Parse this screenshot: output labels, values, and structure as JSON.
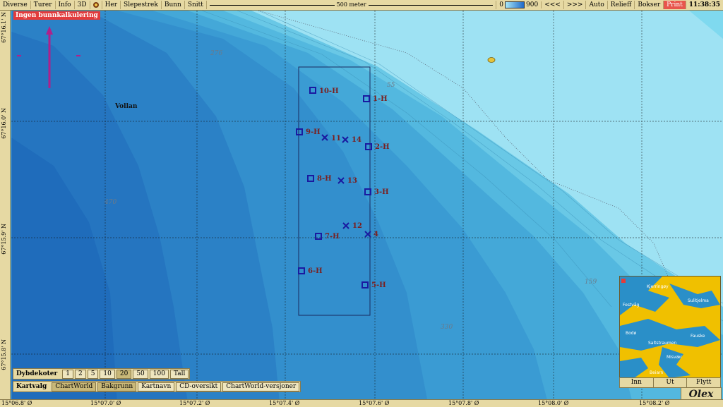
{
  "toolbar": {
    "items": [
      "Diverse",
      "Turer",
      "Info",
      "3D",
      "Her",
      "Slepestrek",
      "Bunn",
      "Snitt"
    ],
    "scale_label": "500 meter",
    "depth_min": "0",
    "depth_max": "900",
    "prev": "<<<",
    "next": ">>>",
    "auto": "Auto",
    "relief": "Relieff",
    "boxes": "Bokser",
    "print": "Print",
    "clock": "11:38:35",
    "colors": {
      "bar": "#e6d9a3",
      "print": "#e8564c"
    }
  },
  "map": {
    "badge": "Ingen bunnkalkulering",
    "place": "Vollan",
    "depths": [
      "276",
      "55",
      "470",
      "330",
      "159"
    ],
    "waypoints_h": [
      "10-H",
      "1-H",
      "9-H",
      "2-H",
      "8-H",
      "3-H",
      "7-H",
      "6-H",
      "5-H"
    ],
    "waypoints_x": [
      "11",
      "14",
      "13",
      "12",
      "4"
    ],
    "colors": {
      "shallow": "#a9e8f6",
      "deep": "#1f69c8",
      "marker": "#1a1aa0"
    }
  },
  "lat_labels": [
    "67°16.1' N",
    "67°16.0' N",
    "67°15.9' N",
    "67°15.8' N"
  ],
  "lon_labels": [
    "15°06.8' Ø",
    "15°07.0' Ø",
    "15°07.2' Ø",
    "15°07.4' Ø",
    "15°07.6' Ø",
    "15°07.8' Ø",
    "15°08.0' Ø",
    "15°08.2' Ø"
  ],
  "dybdekoter": {
    "label": "Dybdekoter",
    "options": [
      "1",
      "2",
      "5",
      "10",
      "20",
      "50",
      "100",
      "Tall"
    ],
    "selected": "20"
  },
  "kartvalg": {
    "label": "Kartvalg",
    "options": [
      "ChartWorld",
      "Bakgrunn",
      "Kartnavn",
      "CD-oversikt",
      "ChartWorld-versjoner"
    ]
  },
  "inset": {
    "buttons": [
      "Inn",
      "Ut",
      "Flytt"
    ],
    "places": [
      "Kjerringøy",
      "Festvåg",
      "Sulitjelma",
      "Fauske",
      "Bodø",
      "Saltstraumen",
      "Misvær",
      "Beiarn"
    ]
  },
  "logo": "Olex"
}
